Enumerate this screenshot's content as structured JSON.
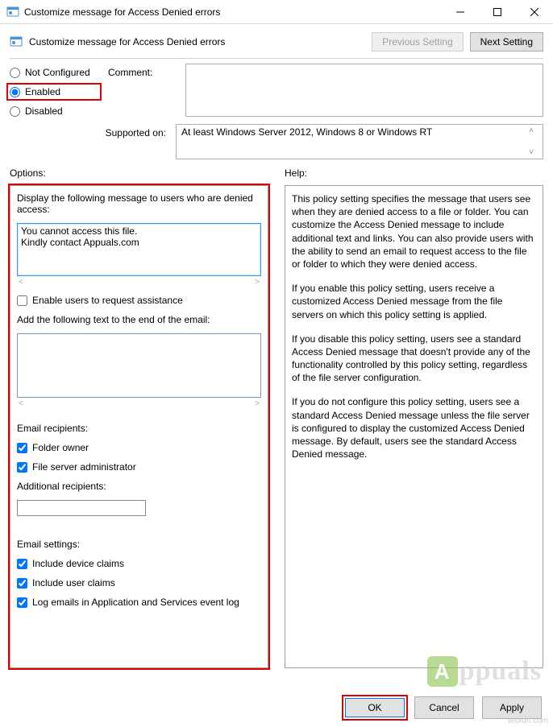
{
  "window": {
    "title": "Customize message for Access Denied errors",
    "subtitle": "Customize message for Access Denied errors"
  },
  "nav": {
    "prev": "Previous Setting",
    "next": "Next Setting"
  },
  "state": {
    "not_configured": "Not Configured",
    "enabled": "Enabled",
    "disabled": "Disabled",
    "comment_label": "Comment:",
    "supported_label": "Supported on:",
    "supported_value": "At least Windows Server 2012, Windows 8 or Windows RT"
  },
  "headers": {
    "options": "Options:",
    "help": "Help:"
  },
  "options": {
    "display_msg_label": "Display the following message to users who are denied access:",
    "display_msg_value": "You cannot access this file.\nKindly contact Appuals.com",
    "enable_assist": "Enable users to request assistance",
    "add_email_label": "Add the following text to the end of the email:",
    "add_email_value": "",
    "recipients_label": "Email recipients:",
    "folder_owner": "Folder owner",
    "server_admin": "File server administrator",
    "additional_label": "Additional recipients:",
    "additional_value": "",
    "settings_label": "Email settings:",
    "device_claims": "Include device claims",
    "user_claims": "Include user claims",
    "log_emails": "Log emails in Application and Services event log"
  },
  "help": {
    "p1": "This policy setting specifies the message that users see when they are denied access to a file or folder. You can customize the Access Denied message to include additional text and links. You can also provide users with the ability to send an email to request access to the file or folder to which they were denied access.",
    "p2": "If you enable this policy setting, users receive a customized Access Denied message from the file servers on which this policy setting is applied.",
    "p3": "If you disable this policy setting, users see a standard Access Denied message that doesn't provide any of the functionality controlled by this policy setting, regardless of the file server configuration.",
    "p4": "If you do not configure this policy setting, users see a standard Access Denied message unless the file server is configured to display the customized Access Denied message. By default, users see the standard Access Denied message."
  },
  "buttons": {
    "ok": "OK",
    "cancel": "Cancel",
    "apply": "Apply"
  },
  "watermark": "ppuals",
  "source_note": "wsxdn.com"
}
